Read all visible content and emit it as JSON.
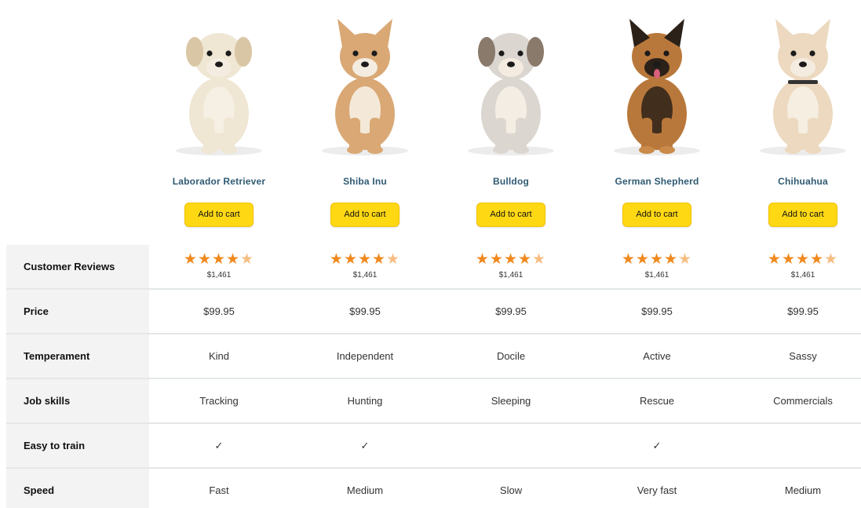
{
  "products": [
    {
      "name": "Laborador Retriever",
      "cart_label": "Add to cart",
      "rating_count": "$1,461",
      "stars": "★★★★",
      "price": "$99.95",
      "temperament": "Kind",
      "job_skill": "Tracking",
      "easy_to_train": "✓",
      "speed": "Fast",
      "coat": "#efe6d3",
      "accent": "#d9c6a4"
    },
    {
      "name": "Shiba Inu",
      "cart_label": "Add to cart",
      "rating_count": "$1,461",
      "stars": "★★★★",
      "price": "$99.95",
      "temperament": "Independent",
      "job_skill": "Hunting",
      "easy_to_train": "✓",
      "speed": "Medium",
      "coat": "#d9a874",
      "accent": "#f1e4d2"
    },
    {
      "name": "Bulldog",
      "cart_label": "Add to cart",
      "rating_count": "$1,461",
      "stars": "★★★★",
      "price": "$99.95",
      "temperament": "Docile",
      "job_skill": "Sleeping",
      "easy_to_train": "",
      "speed": "Slow",
      "coat": "#dcd6d0",
      "accent": "#8a7a6c"
    },
    {
      "name": "German Shepherd",
      "cart_label": "Add to cart",
      "rating_count": "$1,461",
      "stars": "★★★★",
      "price": "$99.95",
      "temperament": "Active",
      "job_skill": "Rescue",
      "easy_to_train": "✓",
      "speed": "Very fast",
      "coat": "#b9783b",
      "accent": "#2b2119"
    },
    {
      "name": "Chihuahua",
      "cart_label": "Add to cart",
      "rating_count": "$1,461",
      "stars": "★★★★",
      "price": "$99.95",
      "temperament": "Sassy",
      "job_skill": "Commercials",
      "easy_to_train": "",
      "speed": "Medium",
      "coat": "#ecd9bf",
      "accent": "#caa783"
    }
  ],
  "rows": {
    "reviews": "Customer Reviews",
    "price": "Price",
    "temperament": "Temperament",
    "job_skills": "Job skills",
    "easy_to_train": "Easy to train",
    "speed": "Speed"
  },
  "colors": {
    "button": "#ffd814",
    "star": "#f0891e",
    "product_link": "#2f5a73",
    "label_bg": "#f3f3f3"
  }
}
